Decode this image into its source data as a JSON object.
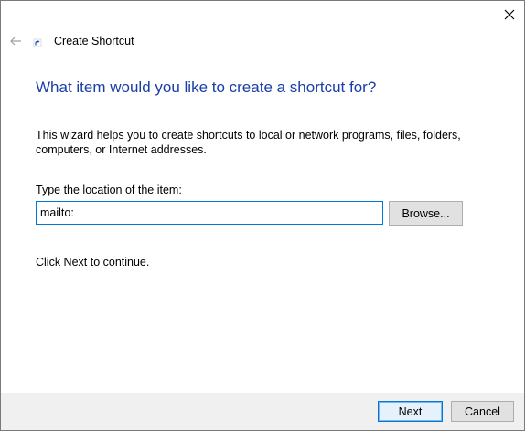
{
  "window": {
    "title": "Create Shortcut",
    "close_icon": "close-icon",
    "back_icon": "back-arrow-icon",
    "wizard_icon": "shortcut-icon"
  },
  "content": {
    "heading": "What item would you like to create a shortcut for?",
    "description": "This wizard helps you to create shortcuts to local or network programs, files, folders, computers, or Internet addresses.",
    "field_label": "Type the location of the item:",
    "location_value": "mailto:",
    "browse_label": "Browse...",
    "continue_text": "Click Next to continue."
  },
  "footer": {
    "next_label": "Next",
    "cancel_label": "Cancel"
  },
  "colors": {
    "heading": "#1a3ea8",
    "accent": "#0078d7",
    "footer_bg": "#f0f0f0",
    "button_bg": "#e1e1e1"
  }
}
